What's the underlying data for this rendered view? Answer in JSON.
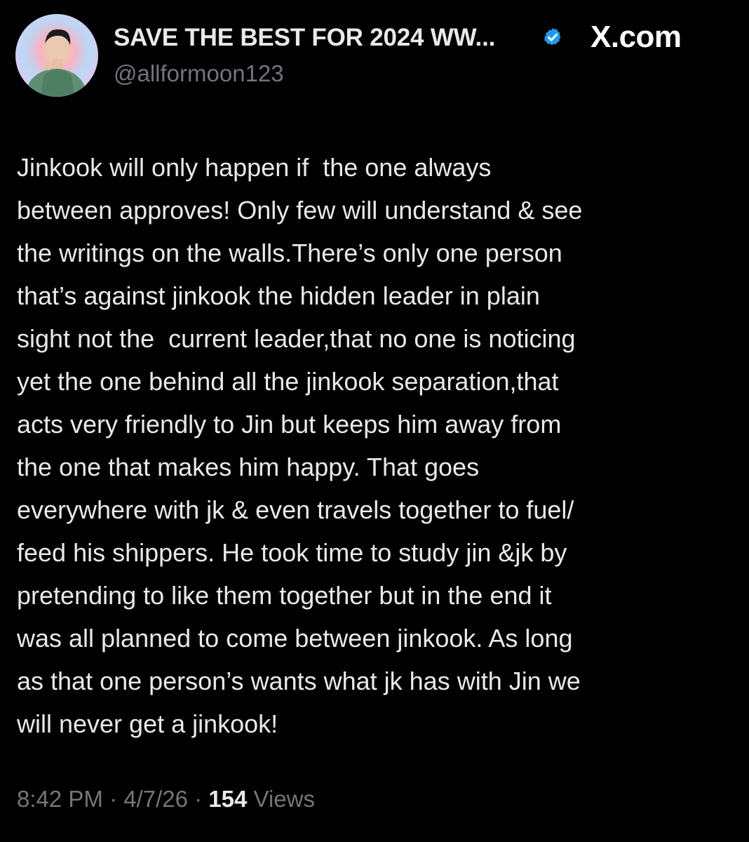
{
  "header": {
    "display_name": "SAVE THE BEST FOR 2024 WW...",
    "handle": "@allformoon123",
    "verified_icon": "verified-badge-icon",
    "watermark": "X.com"
  },
  "tweet": {
    "lines": [
      "Jinkook will only happen if  the one always",
      "between approves! Only few will understand & see",
      "the writings on the walls.There’s only one person",
      "that’s against jinkook the hidden leader in plain",
      "sight not the  current leader,that no one is noticing",
      "yet the one behind all the jinkook separation,that",
      "acts very friendly to Jin but keeps him away from",
      "the one that makes him happy. That goes",
      "everywhere with jk & even travels together to fuel/",
      "feed his shippers. He took time to study jin &jk by",
      "pretending to like them together but in the end it",
      "was all planned to come between jinkook. As long",
      "as that one person’s wants what jk has with Jin we",
      "will never get a jinkook!"
    ]
  },
  "meta": {
    "time": "8:42 PM",
    "separator": " · ",
    "date": "4/7/26",
    "views_count": "154",
    "views_label": " Views"
  },
  "colors": {
    "background": "#000000",
    "primary_text": "#e7e9ea",
    "secondary_text": "#71767b",
    "verified_blue": "#1d9bf0"
  }
}
